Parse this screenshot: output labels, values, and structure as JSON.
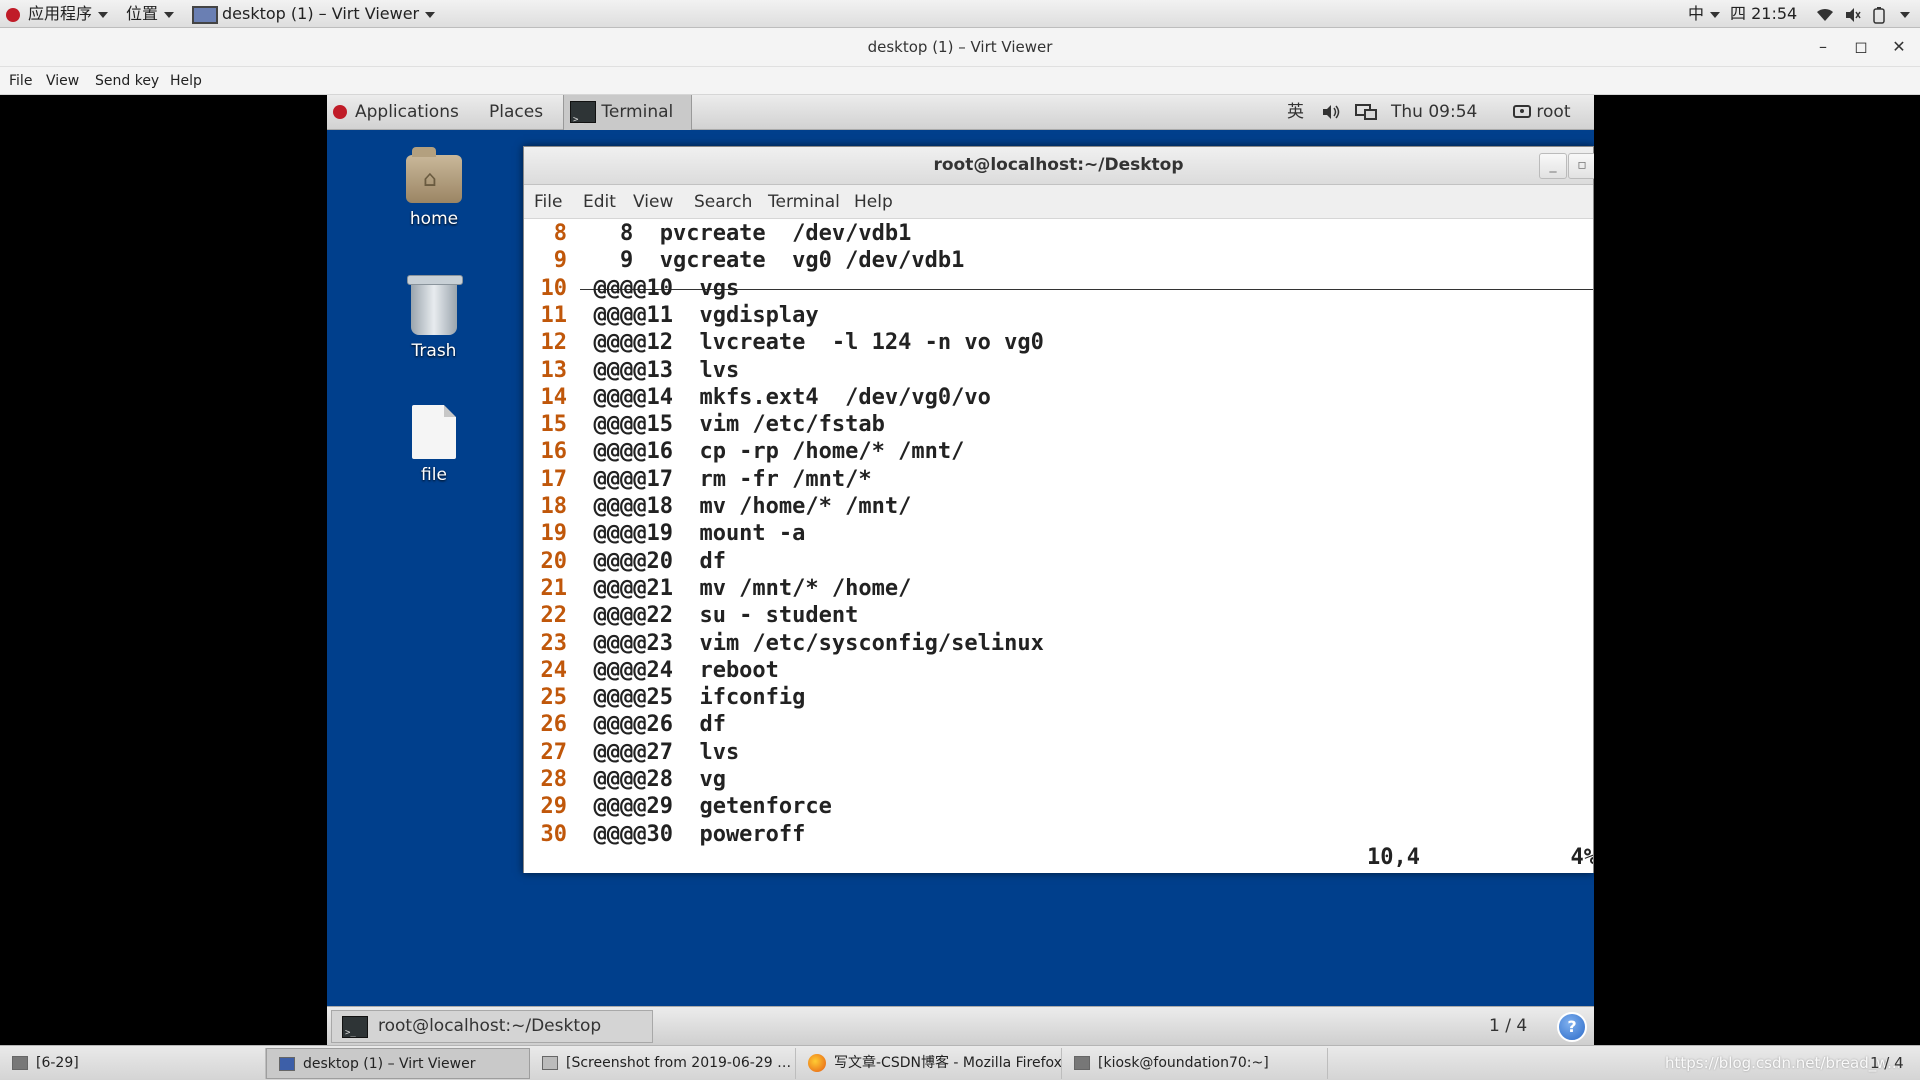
{
  "host_panel": {
    "apps_menu": "应用程序",
    "places_menu": "位置",
    "window_menu": "desktop (1) – Virt Viewer",
    "input_method": "中",
    "clock": "四 21:54"
  },
  "host_window": {
    "title": "desktop (1) – Virt Viewer",
    "menu": [
      "File",
      "View",
      "Send key",
      "Help"
    ]
  },
  "guest_panel": {
    "applications": "Applications",
    "places": "Places",
    "terminal": "Terminal",
    "lang": "英",
    "clock": "Thu 09:54",
    "user": "root"
  },
  "desktop_icons": [
    "home",
    "Trash",
    "file"
  ],
  "terminal": {
    "title": "root@localhost:~/Desktop",
    "menu": [
      "File",
      "Edit",
      "View",
      "Search",
      "Terminal",
      "Help"
    ],
    "lines": [
      {
        "n": "8",
        "text": "    8  pvcreate  /dev/vdb1"
      },
      {
        "n": "9",
        "text": "    9  vgcreate  vg0 /dev/vdb1"
      },
      {
        "n": "10",
        "text": "  @@@@10  vgs"
      },
      {
        "n": "11",
        "text": "  @@@@11  vgdisplay"
      },
      {
        "n": "12",
        "text": "  @@@@12  lvcreate  -l 124 -n vo vg0"
      },
      {
        "n": "13",
        "text": "  @@@@13  lvs"
      },
      {
        "n": "14",
        "text": "  @@@@14  mkfs.ext4  /dev/vg0/vo"
      },
      {
        "n": "15",
        "text": "  @@@@15  vim /etc/fstab"
      },
      {
        "n": "16",
        "text": "  @@@@16  cp -rp /home/* /mnt/"
      },
      {
        "n": "17",
        "text": "  @@@@17  rm -fr /mnt/*"
      },
      {
        "n": "18",
        "text": "  @@@@18  mv /home/* /mnt/"
      },
      {
        "n": "19",
        "text": "  @@@@19  mount -a"
      },
      {
        "n": "20",
        "text": "  @@@@20  df"
      },
      {
        "n": "21",
        "text": "  @@@@21  mv /mnt/* /home/"
      },
      {
        "n": "22",
        "text": "  @@@@22  su - student"
      },
      {
        "n": "23",
        "text": "  @@@@23  vim /etc/sysconfig/selinux"
      },
      {
        "n": "24",
        "text": "  @@@@24  reboot"
      },
      {
        "n": "25",
        "text": "  @@@@25  ifconfig"
      },
      {
        "n": "26",
        "text": "  @@@@26  df"
      },
      {
        "n": "27",
        "text": "  @@@@27  lvs"
      },
      {
        "n": "28",
        "text": "  @@@@28  vg"
      },
      {
        "n": "29",
        "text": "  @@@@29  getenforce"
      },
      {
        "n": "30",
        "text": "  @@@@30  poweroff"
      }
    ],
    "status_position": "10,4",
    "status_percent": "4%"
  },
  "guest_taskbar": {
    "task": "root@localhost:~/Desktop",
    "pager": "1 / 4",
    "help": "?"
  },
  "host_taskbar": {
    "items": [
      "[6-29]",
      "desktop (1) – Virt Viewer",
      "[Screenshot from 2019-06-29 …",
      "写文章-CSDN博客 - Mozilla Firefox",
      "[kiosk@foundation70:~]"
    ],
    "watermark": "https://blog.csdn.net/bread_w...",
    "pager": "1 / 4"
  }
}
